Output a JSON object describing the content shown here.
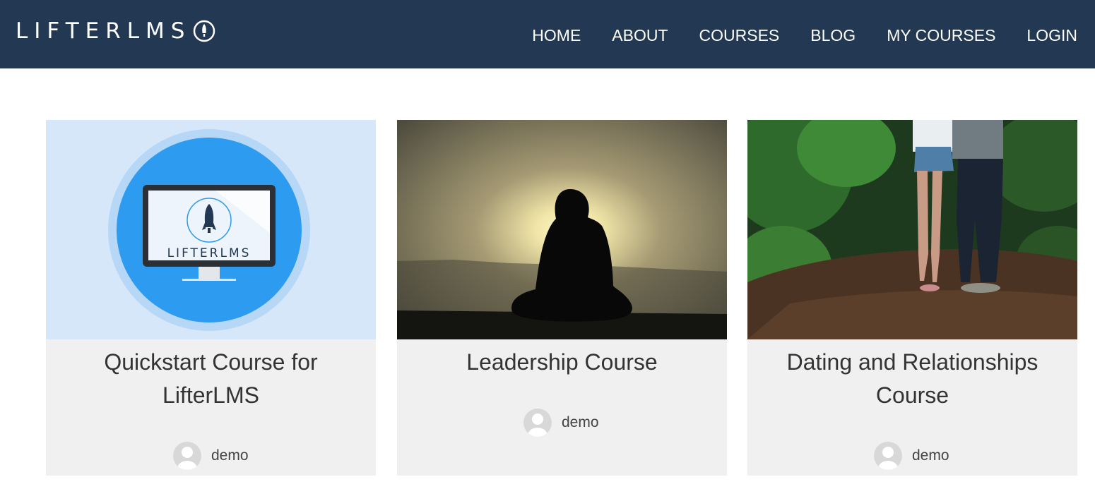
{
  "site": {
    "logo_text": "LIFTERLMS",
    "logo_icon": "rocket-icon"
  },
  "nav": {
    "items": [
      {
        "label": "HOME"
      },
      {
        "label": "ABOUT"
      },
      {
        "label": "COURSES"
      },
      {
        "label": "BLOG"
      },
      {
        "label": "MY COURSES"
      },
      {
        "label": "LOGIN"
      }
    ]
  },
  "courses": [
    {
      "title_line1": "Quickstart Course for",
      "title_line2": "LifterLMS",
      "image_logo_text": "LIFTERLMS",
      "author": "demo"
    },
    {
      "title_line1": "Leadership Course",
      "title_line2": "",
      "author": "demo"
    },
    {
      "title_line1": "Dating and Relationships",
      "title_line2": "Course",
      "author": "demo"
    }
  ],
  "colors": {
    "header_bg": "#233852",
    "card_bg": "#f0f0f0",
    "accent_blue": "#2d9bef"
  }
}
